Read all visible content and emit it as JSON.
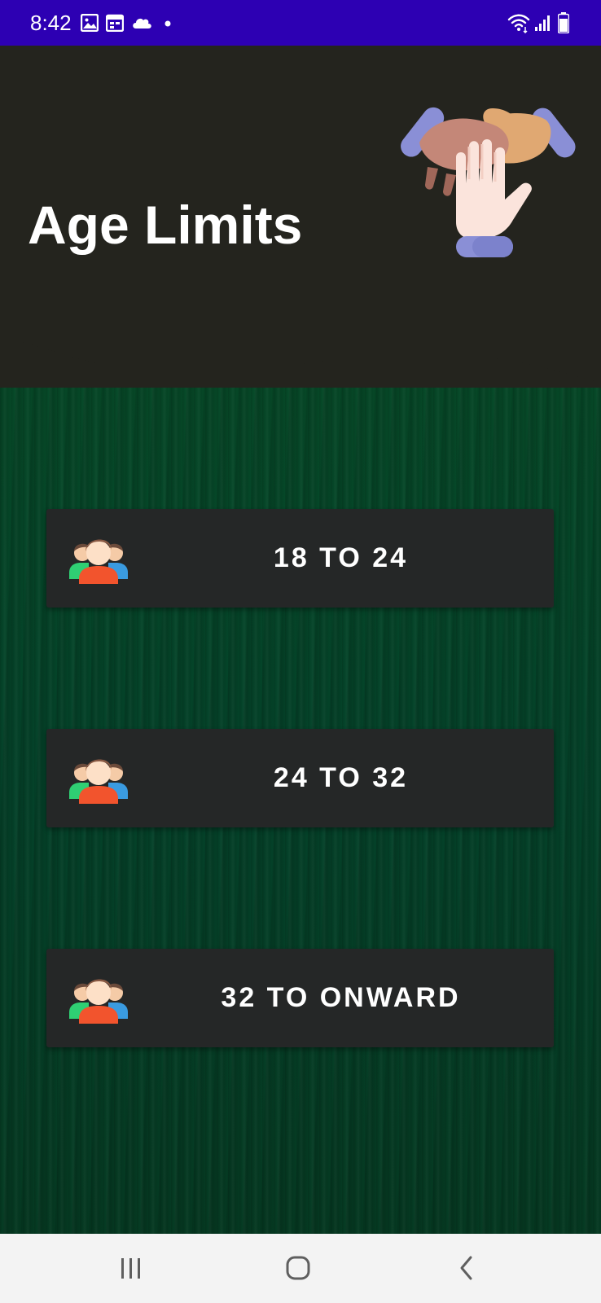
{
  "status_bar": {
    "time": "8:42",
    "icons": [
      "gallery-icon",
      "calendar-icon",
      "cloud-icon",
      "dot-icon",
      "wifi-icon",
      "signal-icon",
      "battery-icon"
    ]
  },
  "header": {
    "title": "Age Limits",
    "illustration": "hands-together-illustration"
  },
  "age_options": [
    {
      "label": "18 TO 24",
      "icon": "group-people-icon"
    },
    {
      "label": "24 TO 32",
      "icon": "group-people-icon"
    },
    {
      "label": "32 TO ONWARD",
      "icon": "group-people-icon"
    }
  ],
  "nav_bar": {
    "buttons": [
      "recent-apps-icon",
      "home-icon",
      "back-icon"
    ]
  },
  "colors": {
    "status_bar": "#2d00b3",
    "header_bg": "#24241e",
    "texture_green": "#064a27",
    "button_bg": "#252727",
    "text": "#ffffff",
    "nav_bar_bg": "#f3f3f3"
  }
}
